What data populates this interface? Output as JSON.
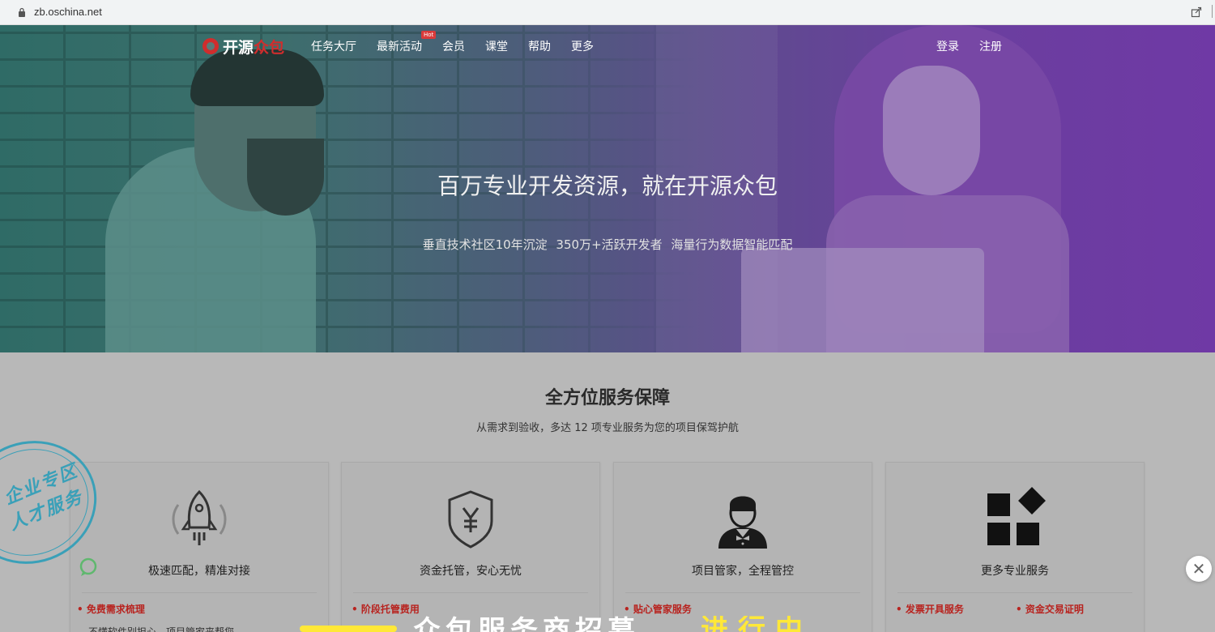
{
  "browser": {
    "url": "zb.oschina.net"
  },
  "nav": {
    "logo_a": "开源",
    "logo_b": "众包",
    "items": [
      "任务大厅",
      "最新活动",
      "会员",
      "课堂",
      "帮助",
      "更多"
    ],
    "hot_badge": "Hot",
    "login": "登录",
    "register": "注册"
  },
  "hero": {
    "title": "百万专业开发资源，就在开源众包",
    "subtitle": "垂直技术社区10年沉淀  350万+活跃开发者  海量行为数据智能匹配"
  },
  "services": {
    "title": "全方位服务保障",
    "subtitle": "从需求到验收，多达 12 项专业服务为您的项目保驾护航",
    "cards": [
      {
        "title": "极速匹配，精准对接",
        "icon": "rocket-icon",
        "features": [
          "免费需求梳理"
        ],
        "desc": "不懂软件别担心，项目管家来帮您"
      },
      {
        "title": "资金托管，安心无忧",
        "icon": "shield-yen-icon",
        "features": [
          "阶段托管费用"
        ],
        "desc": ""
      },
      {
        "title": "项目管家，全程管控",
        "icon": "butler-icon",
        "features": [
          "贴心管家服务"
        ],
        "desc": ""
      },
      {
        "title": "更多专业服务",
        "icon": "grid-diamond-icon",
        "features": [
          "发票开具服务",
          "资金交易证明"
        ],
        "desc": ""
      }
    ]
  },
  "stamp": {
    "line1": "企业专区",
    "line2": "人才服务"
  },
  "banner": {
    "white_text": "众包服务商招募",
    "yellow_text": "进行中"
  },
  "colors": {
    "brand_red": "#d02d2d",
    "hero_left": "#2f6b66",
    "hero_right": "#6f39a5",
    "stamp": "#3aa0b8",
    "feature_red": "#b8231f"
  }
}
